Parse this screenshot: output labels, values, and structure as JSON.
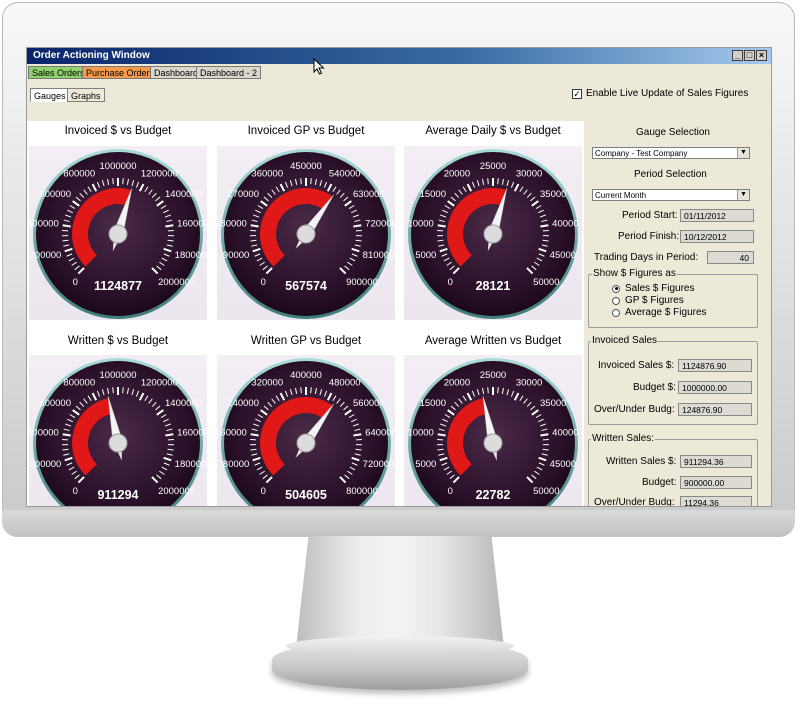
{
  "window": {
    "title": "Order Actioning Window"
  },
  "top_tabs": [
    {
      "label": "Sales Orders",
      "color": "#8fd16a"
    },
    {
      "label": "Purchase Orders",
      "color": "#f59a4a"
    },
    {
      "label": "Dashboard",
      "color": "#d9d6cc"
    },
    {
      "label": "Dashboard - 2",
      "color": "#d9d6cc"
    }
  ],
  "sub_tabs": [
    {
      "label": "Gauges"
    },
    {
      "label": "Graphs"
    }
  ],
  "live_update": {
    "label": "Enable Live Update of Sales Figures",
    "checked": true
  },
  "gauges": [
    {
      "title": "Invoiced $ vs Budget",
      "ticks": [
        "0",
        "200000",
        "400000",
        "600000",
        "800000",
        "1000000",
        "1200000",
        "1400000",
        "1600000",
        "1800000",
        "2000000"
      ],
      "max": 2000000,
      "value": 1124877,
      "display": "1124877"
    },
    {
      "title": "Invoiced GP vs Budget",
      "ticks": [
        "0",
        "90000",
        "180000",
        "270000",
        "360000",
        "450000",
        "540000",
        "630000",
        "720000",
        "810000",
        "900000"
      ],
      "max": 900000,
      "value": 567574,
      "display": "567574"
    },
    {
      "title": "Average Daily $ vs Budget",
      "ticks": [
        "0",
        "5000",
        "10000",
        "15000",
        "20000",
        "25000",
        "30000",
        "35000",
        "40000",
        "45000",
        "50000"
      ],
      "max": 50000,
      "value": 28121,
      "display": "28121"
    },
    {
      "title": "Written $ vs Budget",
      "ticks": [
        "0",
        "200000",
        "400000",
        "600000",
        "800000",
        "1000000",
        "1200000",
        "1400000",
        "1600000",
        "1800000",
        "2000000"
      ],
      "max": 2000000,
      "value": 911294,
      "display": "911294"
    },
    {
      "title": "Written GP vs Budget",
      "ticks": [
        "0",
        "80000",
        "160000",
        "240000",
        "320000",
        "400000",
        "480000",
        "560000",
        "640000",
        "720000",
        "800000"
      ],
      "max": 800000,
      "value": 504605,
      "display": "504605"
    },
    {
      "title": "Average Written vs Budget",
      "ticks": [
        "0",
        "5000",
        "10000",
        "15000",
        "20000",
        "25000",
        "30000",
        "35000",
        "40000",
        "45000",
        "50000"
      ],
      "max": 50000,
      "value": 22782,
      "display": "22782"
    }
  ],
  "panel": {
    "gauge_selection_label": "Gauge Selection",
    "gauge_selection_value": "Company - Test Company",
    "period_selection_label": "Period Selection",
    "period_selection_value": "Current Month",
    "period_start_label": "Period Start:",
    "period_start_value": "01/11/2012",
    "period_finish_label": "Period Finish:",
    "period_finish_value": "10/12/2012",
    "trading_days_label": "Trading Days in Period:",
    "trading_days_value": "40",
    "show_figures_label": "Show $ Figures as",
    "radio_options": [
      "Sales $ Figures",
      "GP $ Figures",
      "Average $ Figures"
    ],
    "radio_selected": 0,
    "invoiced_group": "Invoiced Sales",
    "invoiced_sales_label": "Invoiced Sales $:",
    "invoiced_sales_value": "1124876.90",
    "invoiced_budget_label": "Budget $:",
    "invoiced_budget_value": "1000000.00",
    "invoiced_overunder_label": "Over/Under Budg:",
    "invoiced_overunder_value": "124876.90",
    "written_group": "Written Sales:",
    "written_sales_label": "Written Sales $:",
    "written_sales_value": "911294.36",
    "written_budget_label": "Budget:",
    "written_budget_value": "900000.00",
    "written_overunder_label": "Over/Under Budg:",
    "written_overunder_value": "11294.36"
  }
}
